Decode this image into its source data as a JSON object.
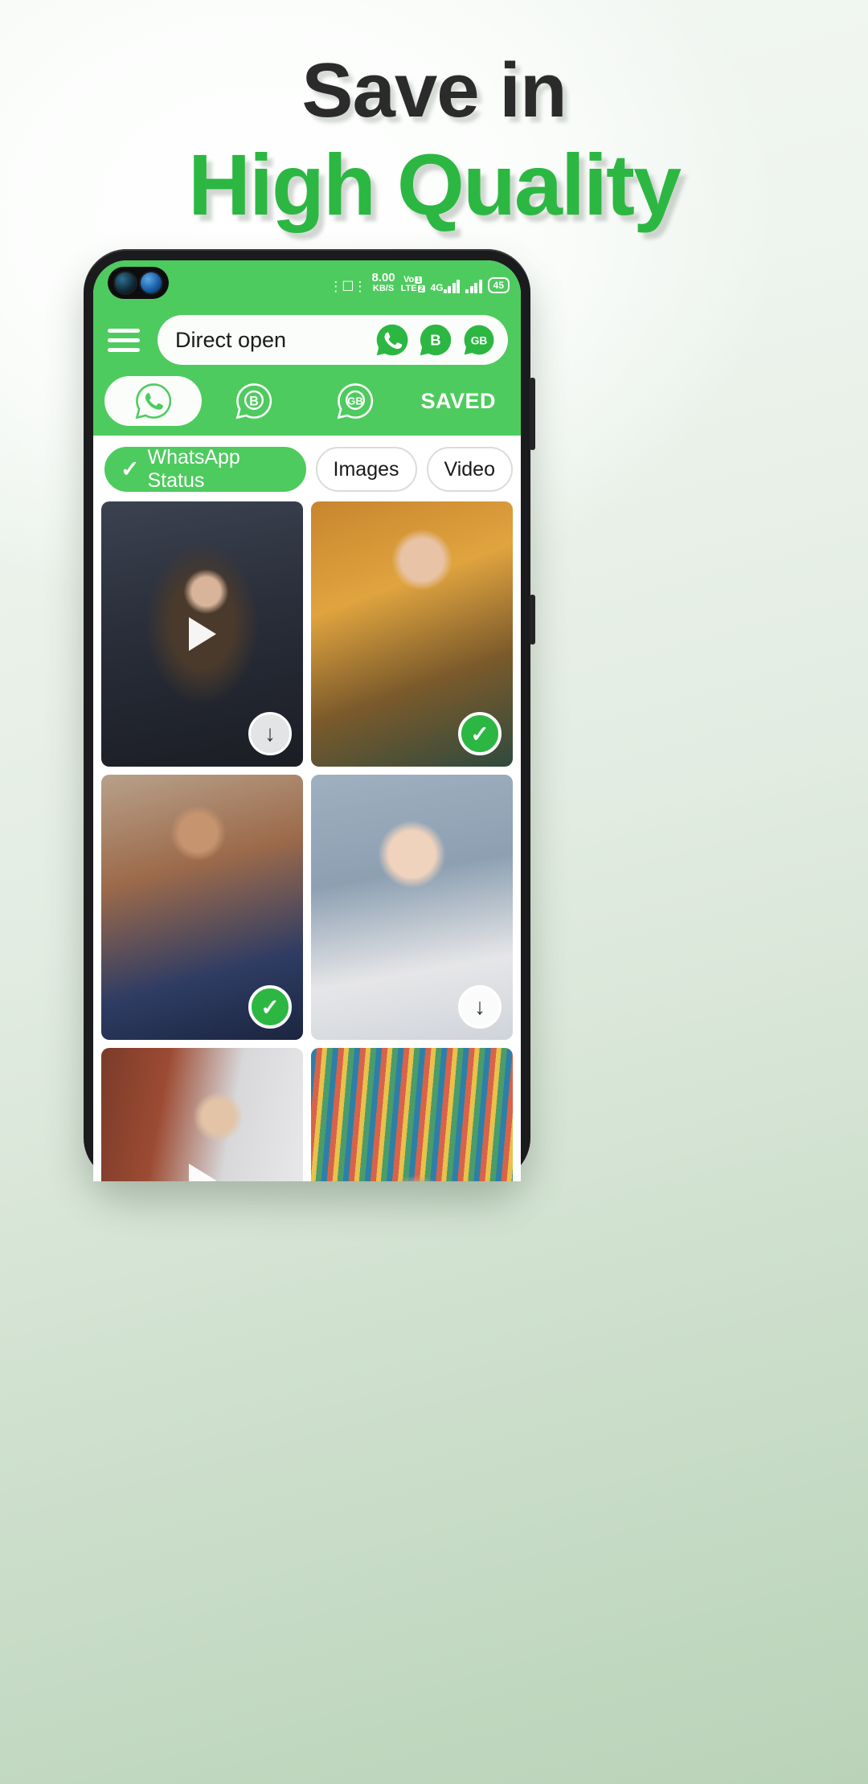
{
  "headline": {
    "line1": "Save in",
    "line2": "High Quality",
    "line1_color": "#2b2b2b",
    "line2_color": "#2CB742"
  },
  "theme": {
    "accent_green": "#4ECB5E",
    "brand_green": "#2CB742",
    "white": "#ffffff"
  },
  "phone": {
    "statusbar": {
      "vibrate_icon": "vibrate-icon",
      "net_speed_value": "8.00",
      "net_speed_unit": "KB/S",
      "volte_line1": "Vo",
      "volte_line2": "LTE",
      "sim1_badge": "1",
      "sim2_badge": "2",
      "network_type": "4G",
      "battery_level": "45"
    },
    "appbar": {
      "menu_icon": "hamburger-menu-icon",
      "search_label": "Direct open",
      "quick_icons": [
        {
          "name": "whatsapp-icon",
          "label": ""
        },
        {
          "name": "whatsapp-business-icon",
          "label": "B"
        },
        {
          "name": "gb-whatsapp-icon",
          "label": "GB"
        }
      ]
    },
    "tabs": [
      {
        "name": "tab-whatsapp",
        "label": "",
        "icon": "whatsapp-icon",
        "active": true
      },
      {
        "name": "tab-business",
        "label": "B",
        "icon": "whatsapp-business-icon",
        "active": false
      },
      {
        "name": "tab-gb",
        "label": "GB",
        "icon": "gb-whatsapp-icon",
        "active": false
      },
      {
        "name": "tab-saved",
        "label": "SAVED",
        "icon": "",
        "active": false
      }
    ],
    "chips": [
      {
        "label": "WhatsApp Status",
        "active": true,
        "tick": "✓"
      },
      {
        "label": "Images",
        "active": false,
        "tick": ""
      },
      {
        "label": "Video",
        "active": false,
        "tick": ""
      }
    ],
    "grid": [
      {
        "name": "status-item-1",
        "badge": "download",
        "badge_glyph": "↓",
        "has_play": true
      },
      {
        "name": "status-item-2",
        "badge": "saved",
        "badge_glyph": "✓",
        "has_play": false
      },
      {
        "name": "status-item-3",
        "badge": "saved",
        "badge_glyph": "✓",
        "has_play": false
      },
      {
        "name": "status-item-4",
        "badge": "download",
        "badge_glyph": "↓",
        "has_play": false
      },
      {
        "name": "status-item-5",
        "badge": "",
        "badge_glyph": "",
        "has_play": true
      },
      {
        "name": "status-item-6",
        "badge": "",
        "badge_glyph": "",
        "has_play": false
      }
    ]
  }
}
